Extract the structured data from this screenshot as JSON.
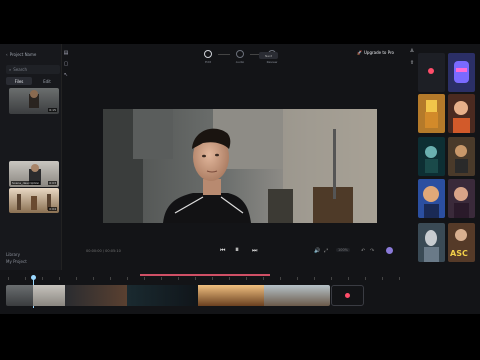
{
  "left_panel": {
    "project_label": "Project Name",
    "search_placeholder": "Search",
    "tabs": [
      {
        "label": "Files",
        "active": true
      },
      {
        "label": "Edit",
        "active": false
      }
    ],
    "clips": [
      {
        "duration": "0:15"
      },
      {
        "caption": "Scene_description",
        "duration": "0:03"
      },
      {
        "duration": "0:04"
      }
    ],
    "footer": [
      {
        "label": "Library"
      },
      {
        "label": "My Project"
      }
    ]
  },
  "header": {
    "steps": [
      {
        "label": "Edit",
        "active": true
      },
      {
        "label": "Audio",
        "active": false
      },
      {
        "label": "Review",
        "active": false
      }
    ],
    "next_label": "Next",
    "upgrade_label": "Upgrade to Pro"
  },
  "player": {
    "timecode": "00:00:00 / 00:05:10",
    "zoom": "100%"
  },
  "right_panel": {
    "thumbs": [
      {
        "caption": "",
        "color": "#2b2f66"
      },
      {
        "caption": "",
        "color": "#b47a2a"
      },
      {
        "caption": "",
        "color": "#4b2a20"
      },
      {
        "caption": "",
        "color": "#0d2e33"
      },
      {
        "caption": "",
        "color": "#4a3a2a"
      },
      {
        "caption": "",
        "color": "#2b4fa0"
      },
      {
        "caption": "",
        "color": "#3a2a3a"
      },
      {
        "caption": "",
        "color": "#3a4a55"
      },
      {
        "caption": "ASC",
        "color": "#553a28"
      }
    ]
  }
}
